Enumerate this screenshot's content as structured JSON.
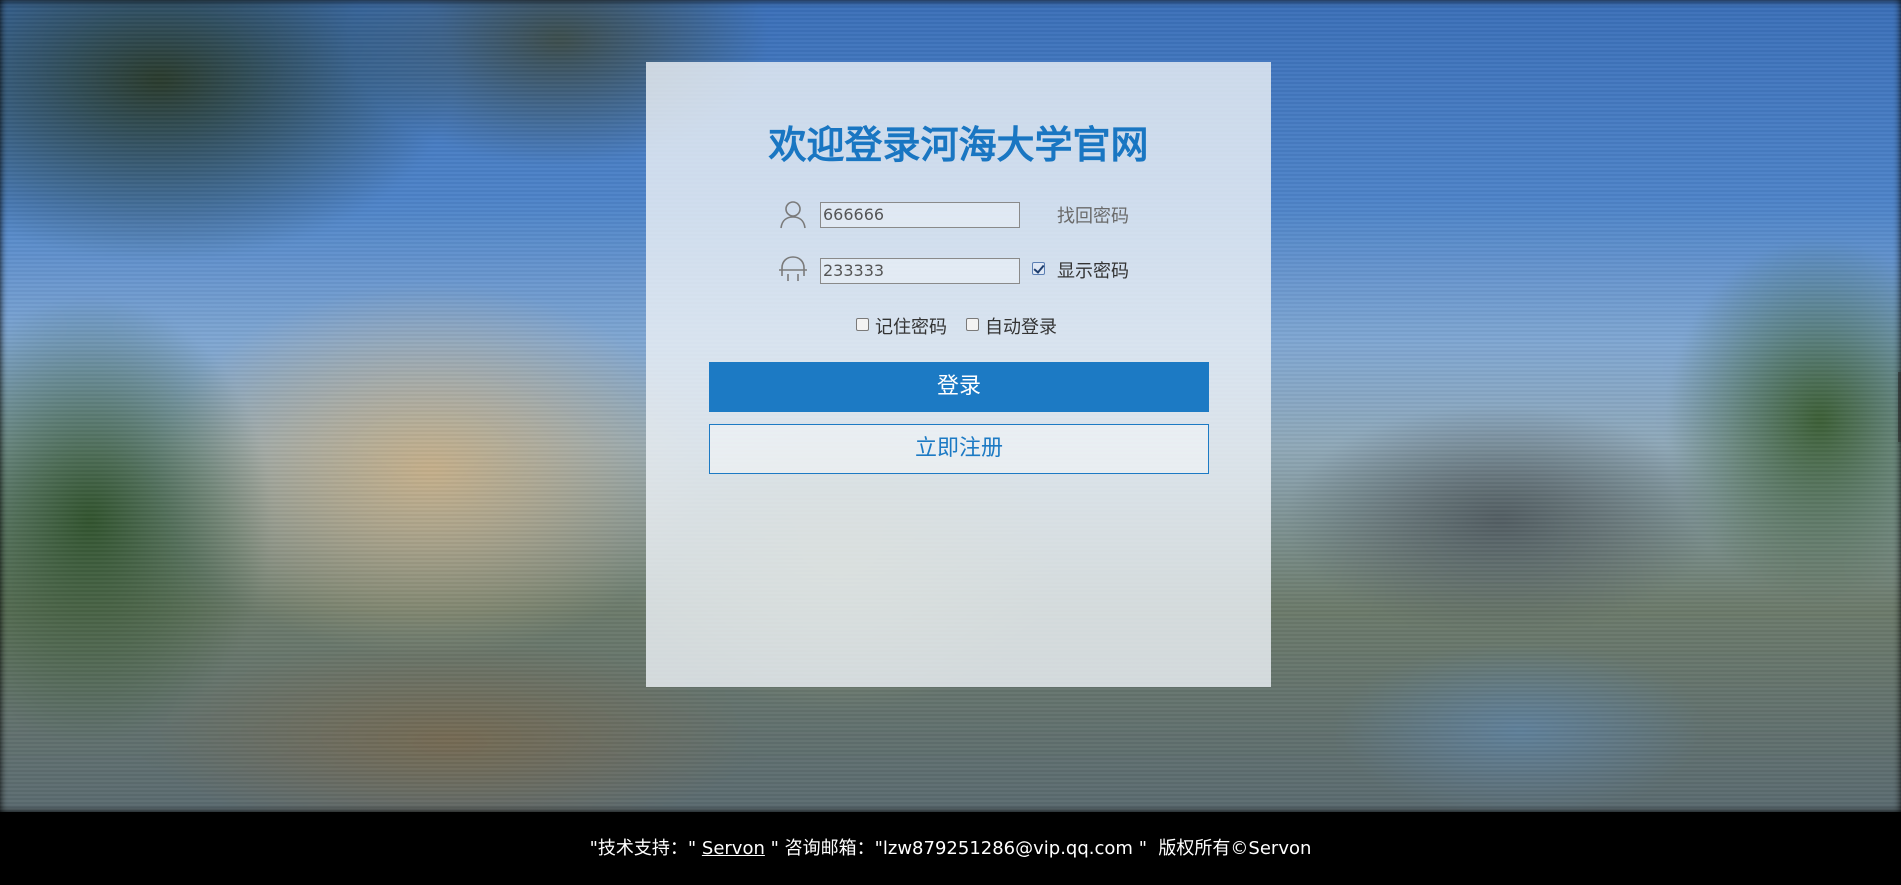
{
  "login": {
    "title": "欢迎登录河海大学官网",
    "username_value": "666666",
    "password_value": "233333",
    "forgot_password_label": "找回密码",
    "show_password_label": "显示密码",
    "show_password_checked": true,
    "remember_password_label": "记住密码",
    "remember_password_checked": false,
    "auto_login_label": "自动登录",
    "auto_login_checked": false,
    "login_button_label": "登录",
    "register_button_label": "立即注册",
    "user_icon": "user-icon",
    "lock_icon": "lock-icon"
  },
  "footer": {
    "tech_support_prefix": "\"技术支持：\"",
    "tech_support_name": "Servon",
    "email_prefix": "\" 咨询邮箱：\"",
    "email": "lzw879251286@vip.qq.com",
    "email_suffix": "\"",
    "copyright": "版权所有©Servon"
  },
  "colors": {
    "accent": "#1c7ac4",
    "title": "#1976c2",
    "footer_bg": "#000000"
  }
}
